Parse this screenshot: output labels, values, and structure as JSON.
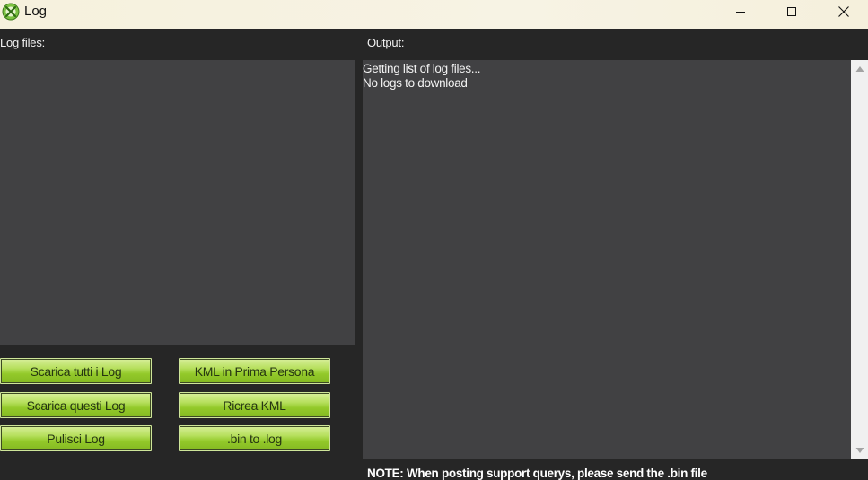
{
  "window": {
    "title": "Log",
    "icon": "app-logo-icon",
    "controls": {
      "minimize_icon": "minimize-icon",
      "maximize_icon": "maximize-icon",
      "close_icon": "close-icon"
    }
  },
  "log_files": {
    "label": "Log files:",
    "items": []
  },
  "output": {
    "label": "Output:",
    "lines": [
      "Getting list of log files...",
      "No logs to download"
    ]
  },
  "buttons": {
    "download_all": "Scarica tutti i Log",
    "download_these": "Scarica questi Log",
    "clear_logs": "Pulisci Log",
    "kml_first_person": "KML in Prima Persona",
    "recreate_kml": "Ricrea KML",
    "bin_to_log": ".bin to .log"
  },
  "note": "NOTE: When posting support querys, please send the .bin file",
  "colors": {
    "background": "#262626",
    "panel": "#414143",
    "button_green": "#9fd13a",
    "titlebar": "#f6f1dd"
  }
}
